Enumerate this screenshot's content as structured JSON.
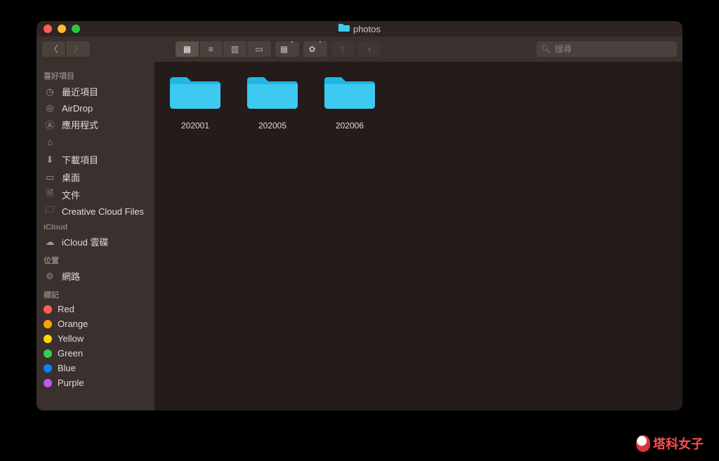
{
  "window": {
    "title": "photos"
  },
  "toolbar": {
    "search_placeholder": "搜尋"
  },
  "sidebar": {
    "favorites_header": "喜好項目",
    "favorites": [
      {
        "icon": "clock",
        "label": "最近項目"
      },
      {
        "icon": "airdrop",
        "label": "AirDrop"
      },
      {
        "icon": "appstore",
        "label": "應用程式"
      },
      {
        "icon": "home",
        "label": "",
        "blur": true
      },
      {
        "icon": "downloads",
        "label": "下載項目"
      },
      {
        "icon": "desktop",
        "label": "桌面"
      },
      {
        "icon": "docs",
        "label": "文件"
      },
      {
        "icon": "folder",
        "label": "Creative Cloud Files"
      }
    ],
    "icloud_header": "iCloud",
    "icloud": [
      {
        "icon": "cloud",
        "label": "iCloud 雲碟"
      }
    ],
    "locations_header": "位置",
    "locations": [
      {
        "icon": "network",
        "label": "網路"
      }
    ],
    "tags_header": "標記",
    "tags": [
      {
        "label": "Red",
        "color": "#ff5f5a"
      },
      {
        "label": "Orange",
        "color": "#ff9f0a"
      },
      {
        "label": "Yellow",
        "color": "#ffd60a"
      },
      {
        "label": "Green",
        "color": "#30d158"
      },
      {
        "label": "Blue",
        "color": "#0a84ff"
      },
      {
        "label": "Purple",
        "color": "#bf5af2"
      }
    ]
  },
  "folders": [
    {
      "name": "202001"
    },
    {
      "name": "202005"
    },
    {
      "name": "202006"
    }
  ],
  "watermark": "塔科女子"
}
